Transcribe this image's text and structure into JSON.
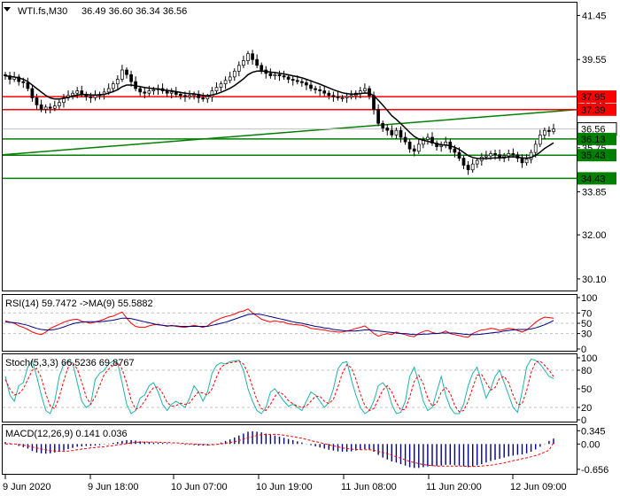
{
  "header": {
    "symbol": "WTI.fs,M30",
    "ohlc": "36.49 36.60 36.34 36.56",
    "icon": "dropdown-triangle-icon"
  },
  "colors": {
    "bull": "#000000",
    "bear": "#000000",
    "ma": "#000000",
    "resistance": "#ff0000",
    "support": "#008000",
    "trendline": "#008000",
    "rsi": "#ff0000",
    "rsi_ma": "#000080",
    "stoch_main": "#20b2aa",
    "stoch_signal": "#ff0000",
    "macd_hist": "#000080",
    "macd_signal": "#ff0000",
    "current_price_bg": "#000000"
  },
  "chart_data": [
    {
      "type": "candlestick",
      "name": "main",
      "y_ticks": [
        "41.45",
        "39.55",
        "37.65",
        "35.75",
        "33.85",
        "32.00",
        "30.10"
      ],
      "x_labels": [
        "9 Jun 2020",
        "9 Jun 18:00",
        "10 Jun 07:00",
        "10 Jun 19:00",
        "11 Jun 08:00",
        "11 Jun 20:00",
        "12 Jun 09:00"
      ],
      "ylim": [
        29.6,
        42.0
      ],
      "price_labels": [
        {
          "label": "37.95",
          "value": 37.95,
          "kind": "resistance"
        },
        {
          "label": "37.39",
          "value": 37.39,
          "kind": "resistance"
        },
        {
          "label": "36.56",
          "value": 36.56,
          "kind": "current"
        },
        {
          "label": "36.13",
          "value": 36.13,
          "kind": "support"
        },
        {
          "label": "35.43",
          "value": 35.43,
          "kind": "support"
        },
        {
          "label": "34.43",
          "value": 34.43,
          "kind": "support"
        }
      ],
      "trendline": {
        "start": 35.45,
        "end": 37.39
      },
      "close": [
        38.85,
        38.7,
        38.8,
        38.6,
        38.55,
        38.3,
        37.9,
        37.6,
        37.4,
        37.5,
        37.45,
        37.55,
        37.7,
        37.9,
        38.0,
        38.1,
        38.2,
        38.05,
        37.95,
        37.9,
        38.0,
        38.05,
        38.15,
        38.3,
        38.5,
        38.7,
        39.1,
        38.9,
        38.6,
        38.3,
        38.15,
        38.1,
        38.2,
        38.25,
        38.3,
        38.2,
        38.1,
        38.15,
        38.05,
        38.0,
        37.95,
        38.0,
        38.05,
        37.9,
        37.85,
        37.95,
        38.2,
        38.35,
        38.5,
        38.65,
        38.8,
        39.05,
        39.3,
        39.5,
        39.8,
        39.55,
        39.3,
        39.1,
        38.95,
        38.85,
        38.9,
        38.85,
        38.8,
        38.7,
        38.65,
        38.6,
        38.55,
        38.45,
        38.3,
        38.25,
        38.2,
        38.1,
        38.0,
        37.95,
        37.9,
        37.9,
        37.95,
        38.0,
        38.1,
        38.2,
        38.3,
        38.0,
        37.4,
        36.8,
        36.6,
        36.5,
        36.3,
        36.5,
        36.2,
        36.0,
        35.7,
        35.6,
        35.9,
        36.1,
        36.2,
        35.95,
        35.8,
        35.85,
        36.0,
        35.7,
        35.55,
        35.3,
        35.0,
        34.8,
        35.05,
        35.2,
        35.35,
        35.4,
        35.5,
        35.45,
        35.3,
        35.4,
        35.5,
        35.45,
        35.3,
        35.1,
        35.25,
        35.55,
        35.9,
        36.3,
        36.5,
        36.45,
        36.56
      ],
      "ma_close": [
        38.85,
        38.82,
        38.8,
        38.75,
        38.7,
        38.6,
        38.45,
        38.3,
        38.15,
        38.0,
        37.9,
        37.85,
        37.85,
        37.88,
        37.92,
        37.97,
        38.02,
        38.04,
        38.04,
        38.02,
        38.02,
        38.03,
        38.05,
        38.1,
        38.17,
        38.25,
        38.38,
        38.45,
        38.45,
        38.42,
        38.38,
        38.35,
        38.32,
        38.3,
        38.28,
        38.25,
        38.22,
        38.2,
        38.17,
        38.13,
        38.1,
        38.08,
        38.07,
        38.04,
        38.0,
        37.99,
        38.02,
        38.07,
        38.14,
        38.22,
        38.31,
        38.43,
        38.57,
        38.72,
        38.9,
        39.0,
        39.05,
        39.06,
        39.04,
        39.01,
        38.99,
        38.96,
        38.93,
        38.89,
        38.85,
        38.81,
        38.76,
        38.7,
        38.63,
        38.56,
        38.49,
        38.41,
        38.33,
        38.25,
        38.18,
        38.12,
        38.08,
        38.06,
        38.06,
        38.08,
        38.11,
        38.1,
        37.99,
        37.8,
        37.58,
        37.36,
        37.13,
        36.97,
        36.79,
        36.6,
        36.41,
        36.24,
        36.13,
        36.07,
        36.03,
        35.98,
        35.92,
        35.88,
        35.87,
        35.83,
        35.77,
        35.68,
        35.55,
        35.41,
        35.33,
        35.29,
        35.28,
        35.28,
        35.3,
        35.31,
        35.31,
        35.33,
        35.35,
        35.36,
        35.35,
        35.31,
        35.3,
        35.33,
        35.42,
        35.56,
        35.72,
        35.84,
        35.96
      ]
    },
    {
      "type": "line",
      "name": "rsi",
      "title": "RSI(14) 59.7472  ->MA(9) 55.5882",
      "y_ticks": [
        "100",
        "70",
        "50",
        "30",
        "0"
      ],
      "ylim": [
        0,
        100
      ],
      "levels": [
        70,
        50,
        30
      ],
      "series": [
        {
          "values": [
            55,
            52,
            50,
            45,
            42,
            38,
            33,
            30,
            28,
            33,
            40,
            44,
            48,
            52,
            55,
            57,
            58,
            54,
            52,
            50,
            53,
            55,
            58,
            62,
            64,
            68,
            72,
            60,
            50,
            44,
            42,
            42,
            45,
            47,
            48,
            46,
            44,
            46,
            44,
            43,
            42,
            44,
            46,
            44,
            42,
            45,
            52,
            56,
            60,
            63,
            65,
            68,
            72,
            74,
            78,
            70,
            64,
            58,
            55,
            53,
            55,
            53,
            52,
            49,
            48,
            47,
            46,
            44,
            40,
            39,
            38,
            37,
            35,
            34,
            33,
            33,
            35,
            37,
            40,
            42,
            45,
            38,
            30,
            25,
            28,
            30,
            28,
            33,
            30,
            28,
            25,
            24,
            30,
            34,
            36,
            32,
            30,
            31,
            35,
            30,
            28,
            26,
            24,
            23,
            30,
            34,
            37,
            38,
            40,
            39,
            36,
            38,
            40,
            39,
            36,
            33,
            37,
            44,
            52,
            58,
            62,
            61,
            60
          ]
        },
        {
          "values": [
            52,
            52,
            51,
            50,
            48,
            46,
            43,
            40,
            38,
            37,
            37,
            38,
            40,
            43,
            46,
            49,
            51,
            52,
            53,
            53,
            53,
            53,
            54,
            55,
            56,
            58,
            60,
            60,
            59,
            57,
            55,
            53,
            51,
            49,
            47,
            46,
            45,
            45,
            45,
            44,
            44,
            44,
            44,
            44,
            44,
            44,
            46,
            48,
            50,
            52,
            55,
            58,
            61,
            64,
            67,
            68,
            68,
            67,
            65,
            63,
            61,
            59,
            57,
            55,
            53,
            51,
            50,
            48,
            46,
            44,
            43,
            41,
            40,
            38,
            37,
            36,
            35,
            35,
            35,
            36,
            37,
            37,
            36,
            35,
            34,
            33,
            32,
            31,
            30,
            30,
            29,
            28,
            28,
            29,
            29,
            30,
            30,
            31,
            31,
            31,
            31,
            30,
            29,
            28,
            28,
            28,
            29,
            30,
            31,
            32,
            33,
            35,
            36,
            37,
            38,
            38,
            38,
            39,
            41,
            44,
            47,
            51,
            55.6
          ]
        }
      ]
    },
    {
      "type": "line",
      "name": "stochastic",
      "title": "Stoch(5,3,3) 66.5236 69.8767",
      "y_ticks": [
        "100",
        "80",
        "50",
        "20",
        "0"
      ],
      "ylim": [
        0,
        100
      ],
      "levels": [
        80,
        20
      ],
      "series": [
        {
          "values": [
            70,
            40,
            30,
            55,
            60,
            85,
            95,
            70,
            40,
            15,
            10,
            30,
            70,
            90,
            95,
            92,
            60,
            30,
            20,
            25,
            65,
            75,
            80,
            90,
            95,
            92,
            60,
            25,
            10,
            15,
            35,
            40,
            55,
            60,
            45,
            25,
            15,
            25,
            30,
            25,
            20,
            35,
            55,
            45,
            30,
            45,
            75,
            88,
            92,
            90,
            94,
            95,
            96,
            80,
            50,
            30,
            15,
            10,
            20,
            45,
            50,
            40,
            30,
            22,
            25,
            20,
            15,
            30,
            45,
            40,
            30,
            20,
            28,
            50,
            82,
            92,
            94,
            65,
            40,
            20,
            10,
            15,
            30,
            55,
            60,
            50,
            25,
            10,
            12,
            30,
            70,
            85,
            60,
            30,
            15,
            20,
            45,
            70,
            40,
            20,
            10,
            10,
            25,
            55,
            75,
            85,
            60,
            35,
            50,
            70,
            80,
            60,
            40,
            20,
            12,
            45,
            85,
            98,
            96,
            90,
            80,
            70,
            66.5
          ]
        },
        {
          "values": [
            65,
            50,
            40,
            42,
            50,
            65,
            80,
            83,
            68,
            42,
            22,
            18,
            37,
            63,
            85,
            92,
            82,
            61,
            37,
            25,
            37,
            55,
            73,
            82,
            88,
            92,
            82,
            59,
            32,
            17,
            20,
            30,
            43,
            52,
            53,
            43,
            28,
            22,
            23,
            27,
            25,
            27,
            37,
            45,
            43,
            40,
            50,
            69,
            85,
            90,
            92,
            93,
            95,
            90,
            75,
            53,
            32,
            18,
            15,
            25,
            38,
            45,
            40,
            31,
            26,
            22,
            20,
            22,
            30,
            38,
            38,
            30,
            26,
            33,
            53,
            75,
            89,
            84,
            66,
            42,
            23,
            15,
            18,
            33,
            48,
            55,
            45,
            28,
            16,
            17,
            37,
            62,
            72,
            58,
            35,
            22,
            27,
            45,
            52,
            43,
            23,
            13,
            15,
            30,
            52,
            72,
            73,
            60,
            48,
            52,
            67,
            70,
            60,
            40,
            24,
            26,
            47,
            76,
            93,
            95,
            88,
            80,
            69.9
          ]
        }
      ]
    },
    {
      "type": "bar",
      "name": "macd",
      "title": "MACD(12,26,9) 0.141  0.036",
      "y_ticks": [
        "0.345",
        "0.00",
        "-0.656"
      ],
      "ylim": [
        -0.75,
        0.42
      ],
      "histogram": [
        0.05,
        0.02,
        0.0,
        -0.05,
        -0.08,
        -0.12,
        -0.18,
        -0.22,
        -0.24,
        -0.25,
        -0.24,
        -0.22,
        -0.2,
        -0.17,
        -0.13,
        -0.1,
        -0.07,
        -0.06,
        -0.05,
        -0.05,
        -0.04,
        -0.03,
        -0.01,
        0.01,
        0.03,
        0.05,
        0.08,
        0.1,
        0.1,
        0.09,
        0.07,
        0.06,
        0.05,
        0.04,
        0.04,
        0.03,
        0.02,
        0.01,
        0.0,
        -0.01,
        -0.02,
        -0.02,
        -0.03,
        -0.04,
        -0.04,
        -0.04,
        -0.02,
        0.01,
        0.04,
        0.08,
        0.12,
        0.17,
        0.22,
        0.27,
        0.32,
        0.33,
        0.32,
        0.3,
        0.27,
        0.24,
        0.22,
        0.19,
        0.16,
        0.13,
        0.1,
        0.07,
        0.04,
        0.01,
        -0.03,
        -0.06,
        -0.09,
        -0.12,
        -0.15,
        -0.17,
        -0.19,
        -0.2,
        -0.2,
        -0.19,
        -0.17,
        -0.15,
        -0.13,
        -0.14,
        -0.2,
        -0.28,
        -0.35,
        -0.4,
        -0.45,
        -0.48,
        -0.52,
        -0.56,
        -0.6,
        -0.62,
        -0.62,
        -0.6,
        -0.58,
        -0.57,
        -0.57,
        -0.56,
        -0.54,
        -0.54,
        -0.55,
        -0.56,
        -0.58,
        -0.6,
        -0.58,
        -0.55,
        -0.52,
        -0.48,
        -0.44,
        -0.41,
        -0.38,
        -0.35,
        -0.32,
        -0.3,
        -0.28,
        -0.27,
        -0.24,
        -0.2,
        -0.14,
        -0.07,
        0.01,
        0.08,
        0.141
      ],
      "signal": [
        0.0,
        0.0,
        0.0,
        -0.01,
        -0.03,
        -0.05,
        -0.08,
        -0.1,
        -0.13,
        -0.15,
        -0.17,
        -0.18,
        -0.19,
        -0.19,
        -0.18,
        -0.17,
        -0.15,
        -0.13,
        -0.12,
        -0.1,
        -0.09,
        -0.08,
        -0.07,
        -0.05,
        -0.04,
        -0.02,
        -0.01,
        0.01,
        0.03,
        0.04,
        0.05,
        0.05,
        0.05,
        0.05,
        0.05,
        0.04,
        0.04,
        0.03,
        0.03,
        0.02,
        0.01,
        0.01,
        0.0,
        -0.01,
        -0.01,
        -0.02,
        -0.02,
        -0.01,
        0.0,
        0.02,
        0.04,
        0.06,
        0.09,
        0.13,
        0.16,
        0.19,
        0.22,
        0.24,
        0.25,
        0.25,
        0.25,
        0.24,
        0.23,
        0.21,
        0.19,
        0.17,
        0.15,
        0.12,
        0.09,
        0.06,
        0.04,
        0.01,
        -0.02,
        -0.05,
        -0.07,
        -0.1,
        -0.12,
        -0.13,
        -0.14,
        -0.15,
        -0.15,
        -0.15,
        -0.16,
        -0.19,
        -0.22,
        -0.25,
        -0.29,
        -0.33,
        -0.37,
        -0.41,
        -0.45,
        -0.48,
        -0.51,
        -0.53,
        -0.55,
        -0.56,
        -0.57,
        -0.57,
        -0.57,
        -0.57,
        -0.57,
        -0.57,
        -0.57,
        -0.58,
        -0.58,
        -0.58,
        -0.57,
        -0.56,
        -0.55,
        -0.53,
        -0.51,
        -0.49,
        -0.46,
        -0.43,
        -0.41,
        -0.38,
        -0.36,
        -0.33,
        -0.3,
        -0.26,
        -0.21,
        -0.16,
        0.036
      ]
    }
  ]
}
